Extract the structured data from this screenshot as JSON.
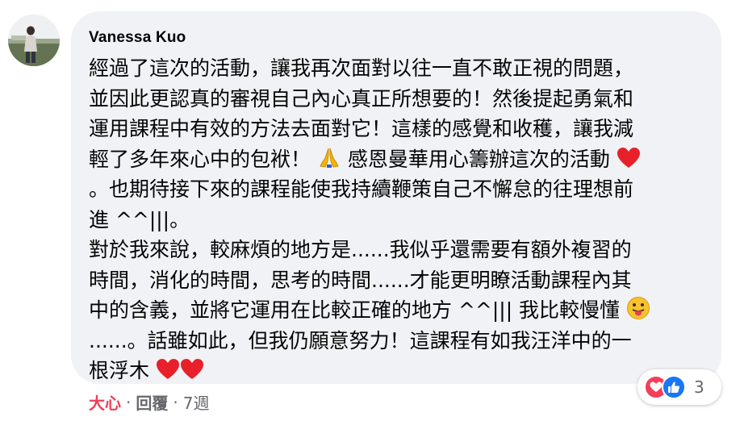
{
  "comment": {
    "author": "Vanessa Kuo",
    "lines": [
      "經過了這次的活動，讓我再次面對以往一直不敢正視的問題，",
      "並因此更認真的審視自己內心真正所想要的！然後提起勇氣和",
      "運用課程中有效的方法去面對它！這樣的感覺和收穫，讓我減",
      "輕了多年來心中的包袱！",
      "感恩曼華用心籌辦這次的活動",
      "。也期待接下來的課程能使我持續鞭策自己不懈怠的往理想前",
      "進 ^^|||。",
      "對於我來說，較麻煩的地方是......我似乎還需要有額外複習的",
      "時間，消化的時間，思考的時間......才能更明瞭活動課程內其",
      "中的含義，並將它運用在比較正確的地方 ^^||| 我比較慢懂",
      "......。話雖如此，但我仍願意努力！這課程有如我汪洋中的一",
      "根浮木"
    ],
    "emojis": {
      "pray": "folded-hands",
      "heart": "red-heart",
      "tongue": "face-with-tongue"
    }
  },
  "reactions": {
    "types": [
      "love",
      "like"
    ],
    "count": "3"
  },
  "actions": {
    "love_label": "大心",
    "separator": "·",
    "reply_label": "回覆",
    "time": "7週"
  },
  "colors": {
    "bubble": "#f0f2f5",
    "love": "#f33e58",
    "like": "#1877f2",
    "secondary_text": "#65676b"
  }
}
